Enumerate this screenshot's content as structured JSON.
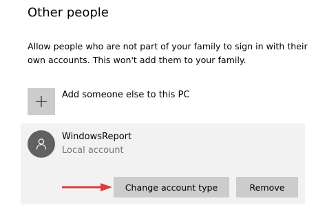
{
  "section": {
    "title": "Other people",
    "description": "Allow people who are not part of your family to sign in with their own accounts. This won't add them to your family."
  },
  "add_user": {
    "label": "Add someone else to this PC",
    "icon": "plus-icon"
  },
  "account": {
    "name": "WindowsReport",
    "type": "Local account",
    "avatar_icon": "person-icon"
  },
  "actions": {
    "change_label": "Change account type",
    "remove_label": "Remove"
  },
  "colors": {
    "tile_bg": "#cccccc",
    "panel_bg": "#f2f2f2",
    "avatar_bg": "#616161",
    "secondary_text": "#767676",
    "annotation_arrow": "#e03a3a"
  }
}
